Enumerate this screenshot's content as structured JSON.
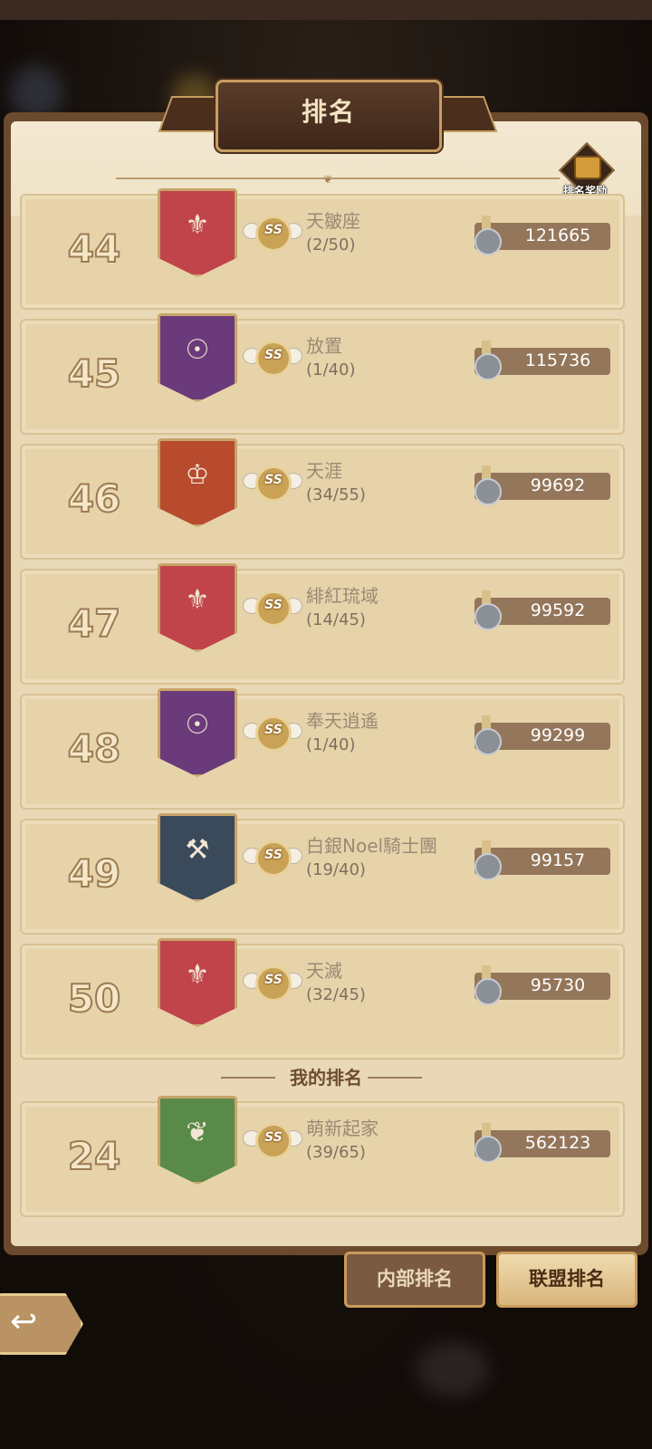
{
  "title": "排名",
  "reward_label": "排名奖励",
  "rows": [
    {
      "rank": "44",
      "name": "天皺座",
      "count": "(2/50)",
      "power": "121665",
      "banner": "red-fleur",
      "banner_color": "#c0444a"
    },
    {
      "rank": "45",
      "name": "放置",
      "count": "(1/40)",
      "power": "115736",
      "banner": "purple-eye",
      "banner_color": "#6a3a7a"
    },
    {
      "rank": "46",
      "name": "天涯",
      "count": "(34/55)",
      "power": "99692",
      "banner": "king",
      "banner_color": "#b84a2e"
    },
    {
      "rank": "47",
      "name": "緋紅琉域",
      "count": "(14/45)",
      "power": "99592",
      "banner": "red-fleur",
      "banner_color": "#c0444a"
    },
    {
      "rank": "48",
      "name": "奉天逍遙",
      "count": "(1/40)",
      "power": "99299",
      "banner": "purple-eye",
      "banner_color": "#6a3a7a"
    },
    {
      "rank": "49",
      "name": "白銀Noel騎士團",
      "count": "(19/40)",
      "power": "99157",
      "banner": "hammer",
      "banner_color": "#3a4a5a"
    },
    {
      "rank": "50",
      "name": "天滅",
      "count": "(32/45)",
      "power": "95730",
      "banner": "red-fleur",
      "banner_color": "#c0444a"
    }
  ],
  "my_rank_label": "我的排名",
  "my_row": {
    "rank": "24",
    "name": "萌新起家",
    "count": "(39/65)",
    "power": "562123",
    "banner": "green-leaf",
    "banner_color": "#5a8a4a"
  },
  "badge_text": "SS",
  "tabs": {
    "internal": "内部排名",
    "alliance": "联盟排名"
  },
  "back_icon": "back-arrow-icon"
}
